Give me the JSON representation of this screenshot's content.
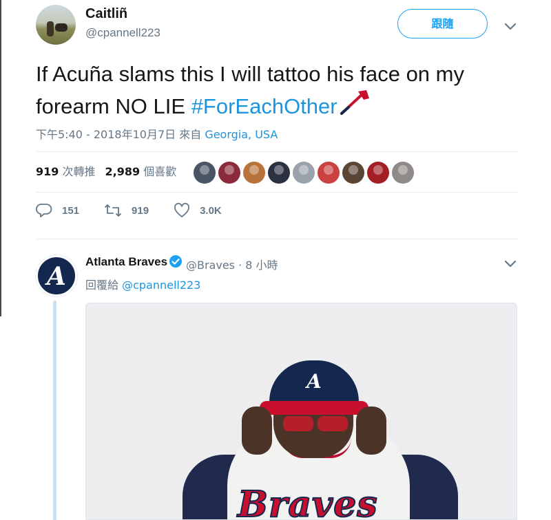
{
  "author": {
    "name": "Caitliñ",
    "handle": "@cpannell223",
    "follow_label": "跟隨"
  },
  "tweet": {
    "text_main": "If Acuña slams this I will tattoo his face on my forearm NO LIE ",
    "hashtag": "#ForEachOther",
    "timestamp": "下午5:40 - 2018年10月7日 來自 ",
    "location": "Georgia, USA"
  },
  "stats": {
    "retweets_count": "919",
    "retweets_label": "次轉推",
    "likes_count": "2,989",
    "likes_label": "個喜歡"
  },
  "likers_colors": [
    "#4a5566",
    "#8a2a3a",
    "#b8733a",
    "#2b3140",
    "#9aa3ab",
    "#c9423f",
    "#5b4636",
    "#a41f25",
    "#8f8a87"
  ],
  "actions": {
    "replies": "151",
    "retweets": "919",
    "likes": "3.0K"
  },
  "reply": {
    "name": "Atlanta Braves",
    "handle_time": "@Braves · 8 小時",
    "reply_to_label": "回覆給 ",
    "reply_to_mention": "@cpannell223",
    "avatar_letter": "A",
    "cap_letter": "A",
    "jersey_text": "Braves"
  },
  "colors": {
    "accent": "#1da1f2",
    "link": "#1b95e0",
    "muted": "#657786",
    "braves_navy": "#13274f",
    "braves_red": "#c8102e"
  },
  "icons": [
    "chevron-down-icon",
    "tomahawk-emoji-icon",
    "reply-icon",
    "retweet-icon",
    "like-icon",
    "verified-badge-icon"
  ]
}
